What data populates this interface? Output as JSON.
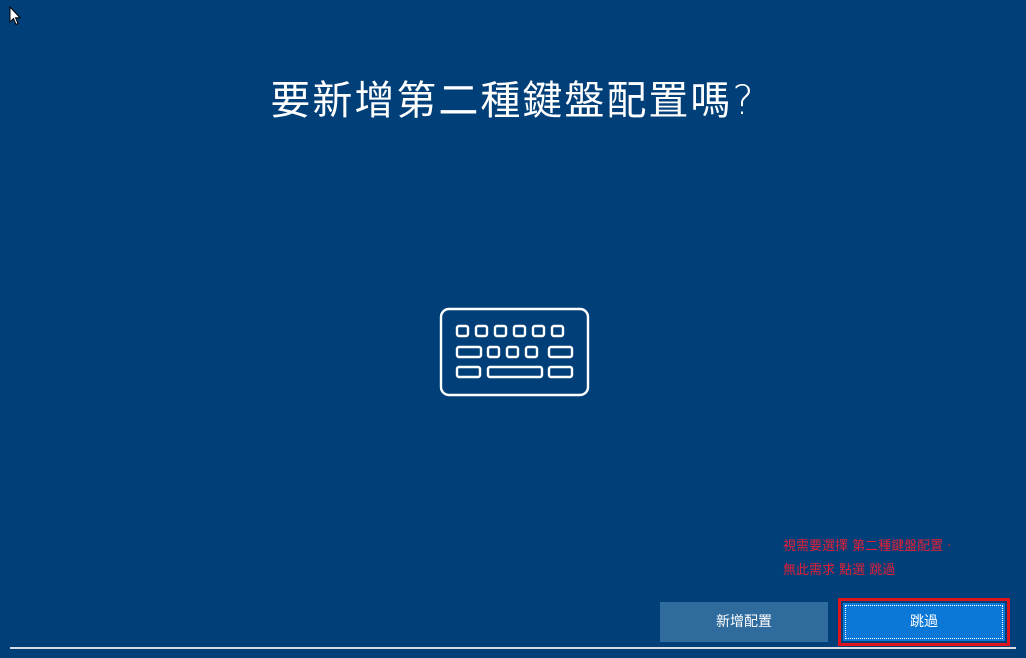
{
  "page": {
    "title": "要新增第二種鍵盤配置嗎?"
  },
  "annotation": {
    "line1": "視需要選擇 第二種鍵盤配置 ·",
    "line2": "無此需求 點選 跳過",
    "color": "#e0203a"
  },
  "buttons": {
    "add_layout": "新增配置",
    "skip": "跳過"
  },
  "icons": {
    "center": "keyboard-icon",
    "pointer": "mouse-cursor-icon"
  },
  "colors": {
    "background": "#003f77",
    "add_button": "#2f6b9d",
    "skip_button": "#0b78d7",
    "highlight_frame": "#e1141e"
  }
}
